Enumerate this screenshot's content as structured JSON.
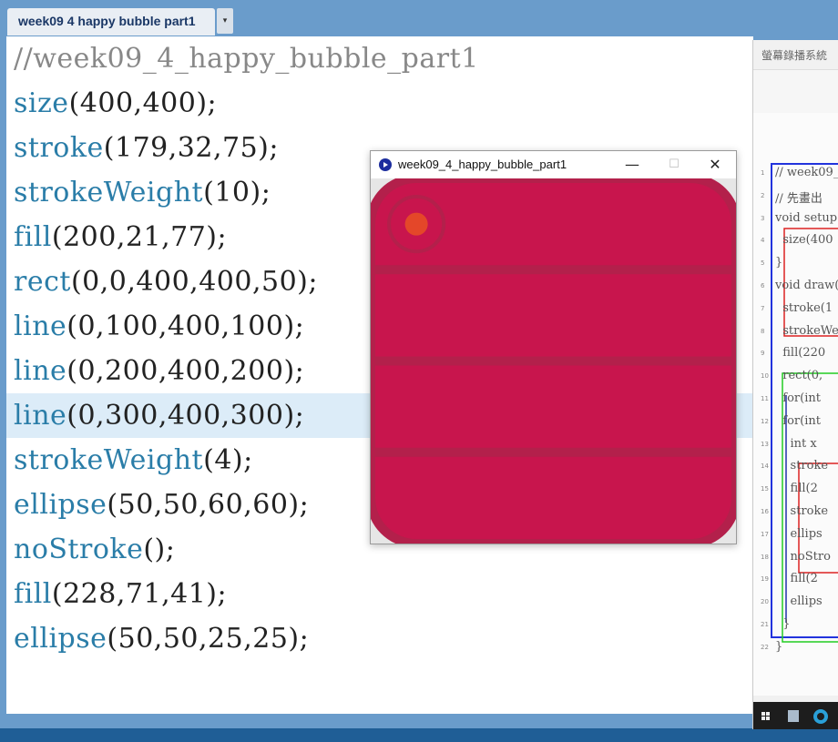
{
  "tab": {
    "label": "week09 4 happy bubble part1",
    "arrow": "▾"
  },
  "editor": {
    "lines": [
      "//week09_4_happy_bubble_part1",
      "size(400,400);",
      "stroke(179,32,75);",
      "strokeWeight(10);",
      "fill(200,21,77);",
      "rect(0,0,400,400,50);",
      "line(0,100,400,100);",
      "line(0,200,400,200);",
      "line(0,300,400,300);",
      "strokeWeight(4);",
      "ellipse(50,50,60,60);",
      "noStroke();",
      "fill(228,71,41);",
      "ellipse(50,50,25,25);"
    ],
    "highlighted_line": 8
  },
  "sketch_window": {
    "title": "week09_4_happy_bubble_part1",
    "minimize": "—",
    "maximize": "☐",
    "close": "✕",
    "rect_fill": "#c8154d",
    "stroke_color": "#b3204b",
    "inner_circle": "#e44729"
  },
  "capture_window": {
    "title": "螢幕錄播系統",
    "code_lines": [
      "// week09_",
      "// 先畫出",
      "void setup",
      "  size(400",
      "}",
      "void draw(",
      "  stroke(1",
      "  strokeWe",
      "  fill(220",
      "  rect(0,",
      "  for(int",
      "  for(int",
      "    int x",
      "    stroke",
      "    fill(2",
      "    stroke",
      "    ellips",
      "    noStro",
      "    fill(2",
      "    ellips",
      "  }",
      "}"
    ]
  },
  "colors": {
    "accent": "#6a9ccb",
    "highlight": "#dcecf8",
    "keyword": "#2a7da8"
  }
}
